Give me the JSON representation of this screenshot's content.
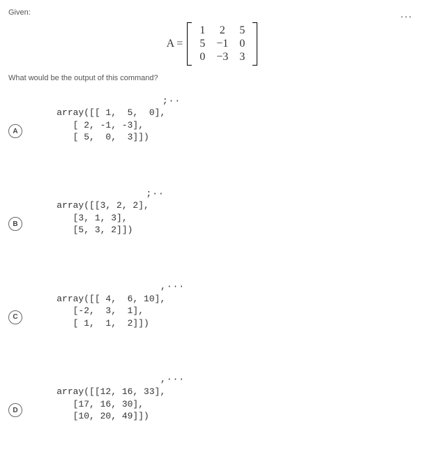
{
  "given_label": "Given:",
  "matrix_label": "A =",
  "matrix_rows": [
    [
      "1",
      "2",
      "5"
    ],
    [
      "5",
      "−1",
      "0"
    ],
    [
      "0",
      "−3",
      "3"
    ]
  ],
  "question_text": "What would be the output of this command?",
  "top_dots": "...",
  "options": {
    "a": {
      "letter": "A",
      "code": "array([[ 1,  5,  0],\n       [ 2, -1, -3],\n       [ 5,  0,  3]])",
      "dots": ";··"
    },
    "b": {
      "letter": "B",
      "code": "array([[3, 2, 2],\n       [3, 1, 3],\n       [5, 3, 2]])",
      "dots": ";··"
    },
    "c": {
      "letter": "C",
      "code": "array([[ 4,  6, 10],\n       [-2,  3,  1],\n       [ 1,  1,  2]])",
      "dots": ",···"
    },
    "d": {
      "letter": "D",
      "code": "array([[12, 16, 33],\n       [17, 16, 30],\n       [10, 20, 49]])",
      "dots": ",···"
    }
  }
}
